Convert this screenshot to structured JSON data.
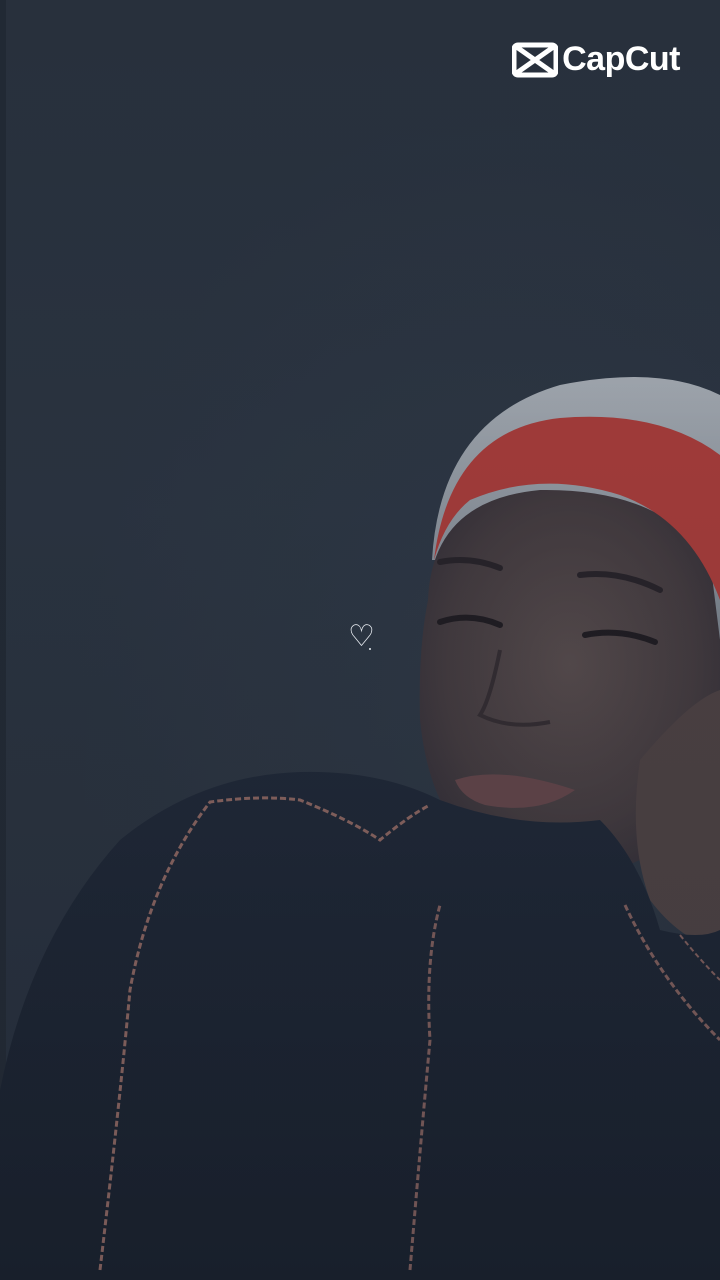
{
  "watermark": {
    "text": "CapCut",
    "icon": "capcut-logo-icon"
  },
  "overlay": {
    "heart_glyph": "♡"
  },
  "colors": {
    "background": "#2b3441",
    "headscarf": "#c9d0d8",
    "headband": "#d8433d",
    "skin": "#5a4a48",
    "garment": "#1a2232",
    "trim": "#b07a70"
  }
}
